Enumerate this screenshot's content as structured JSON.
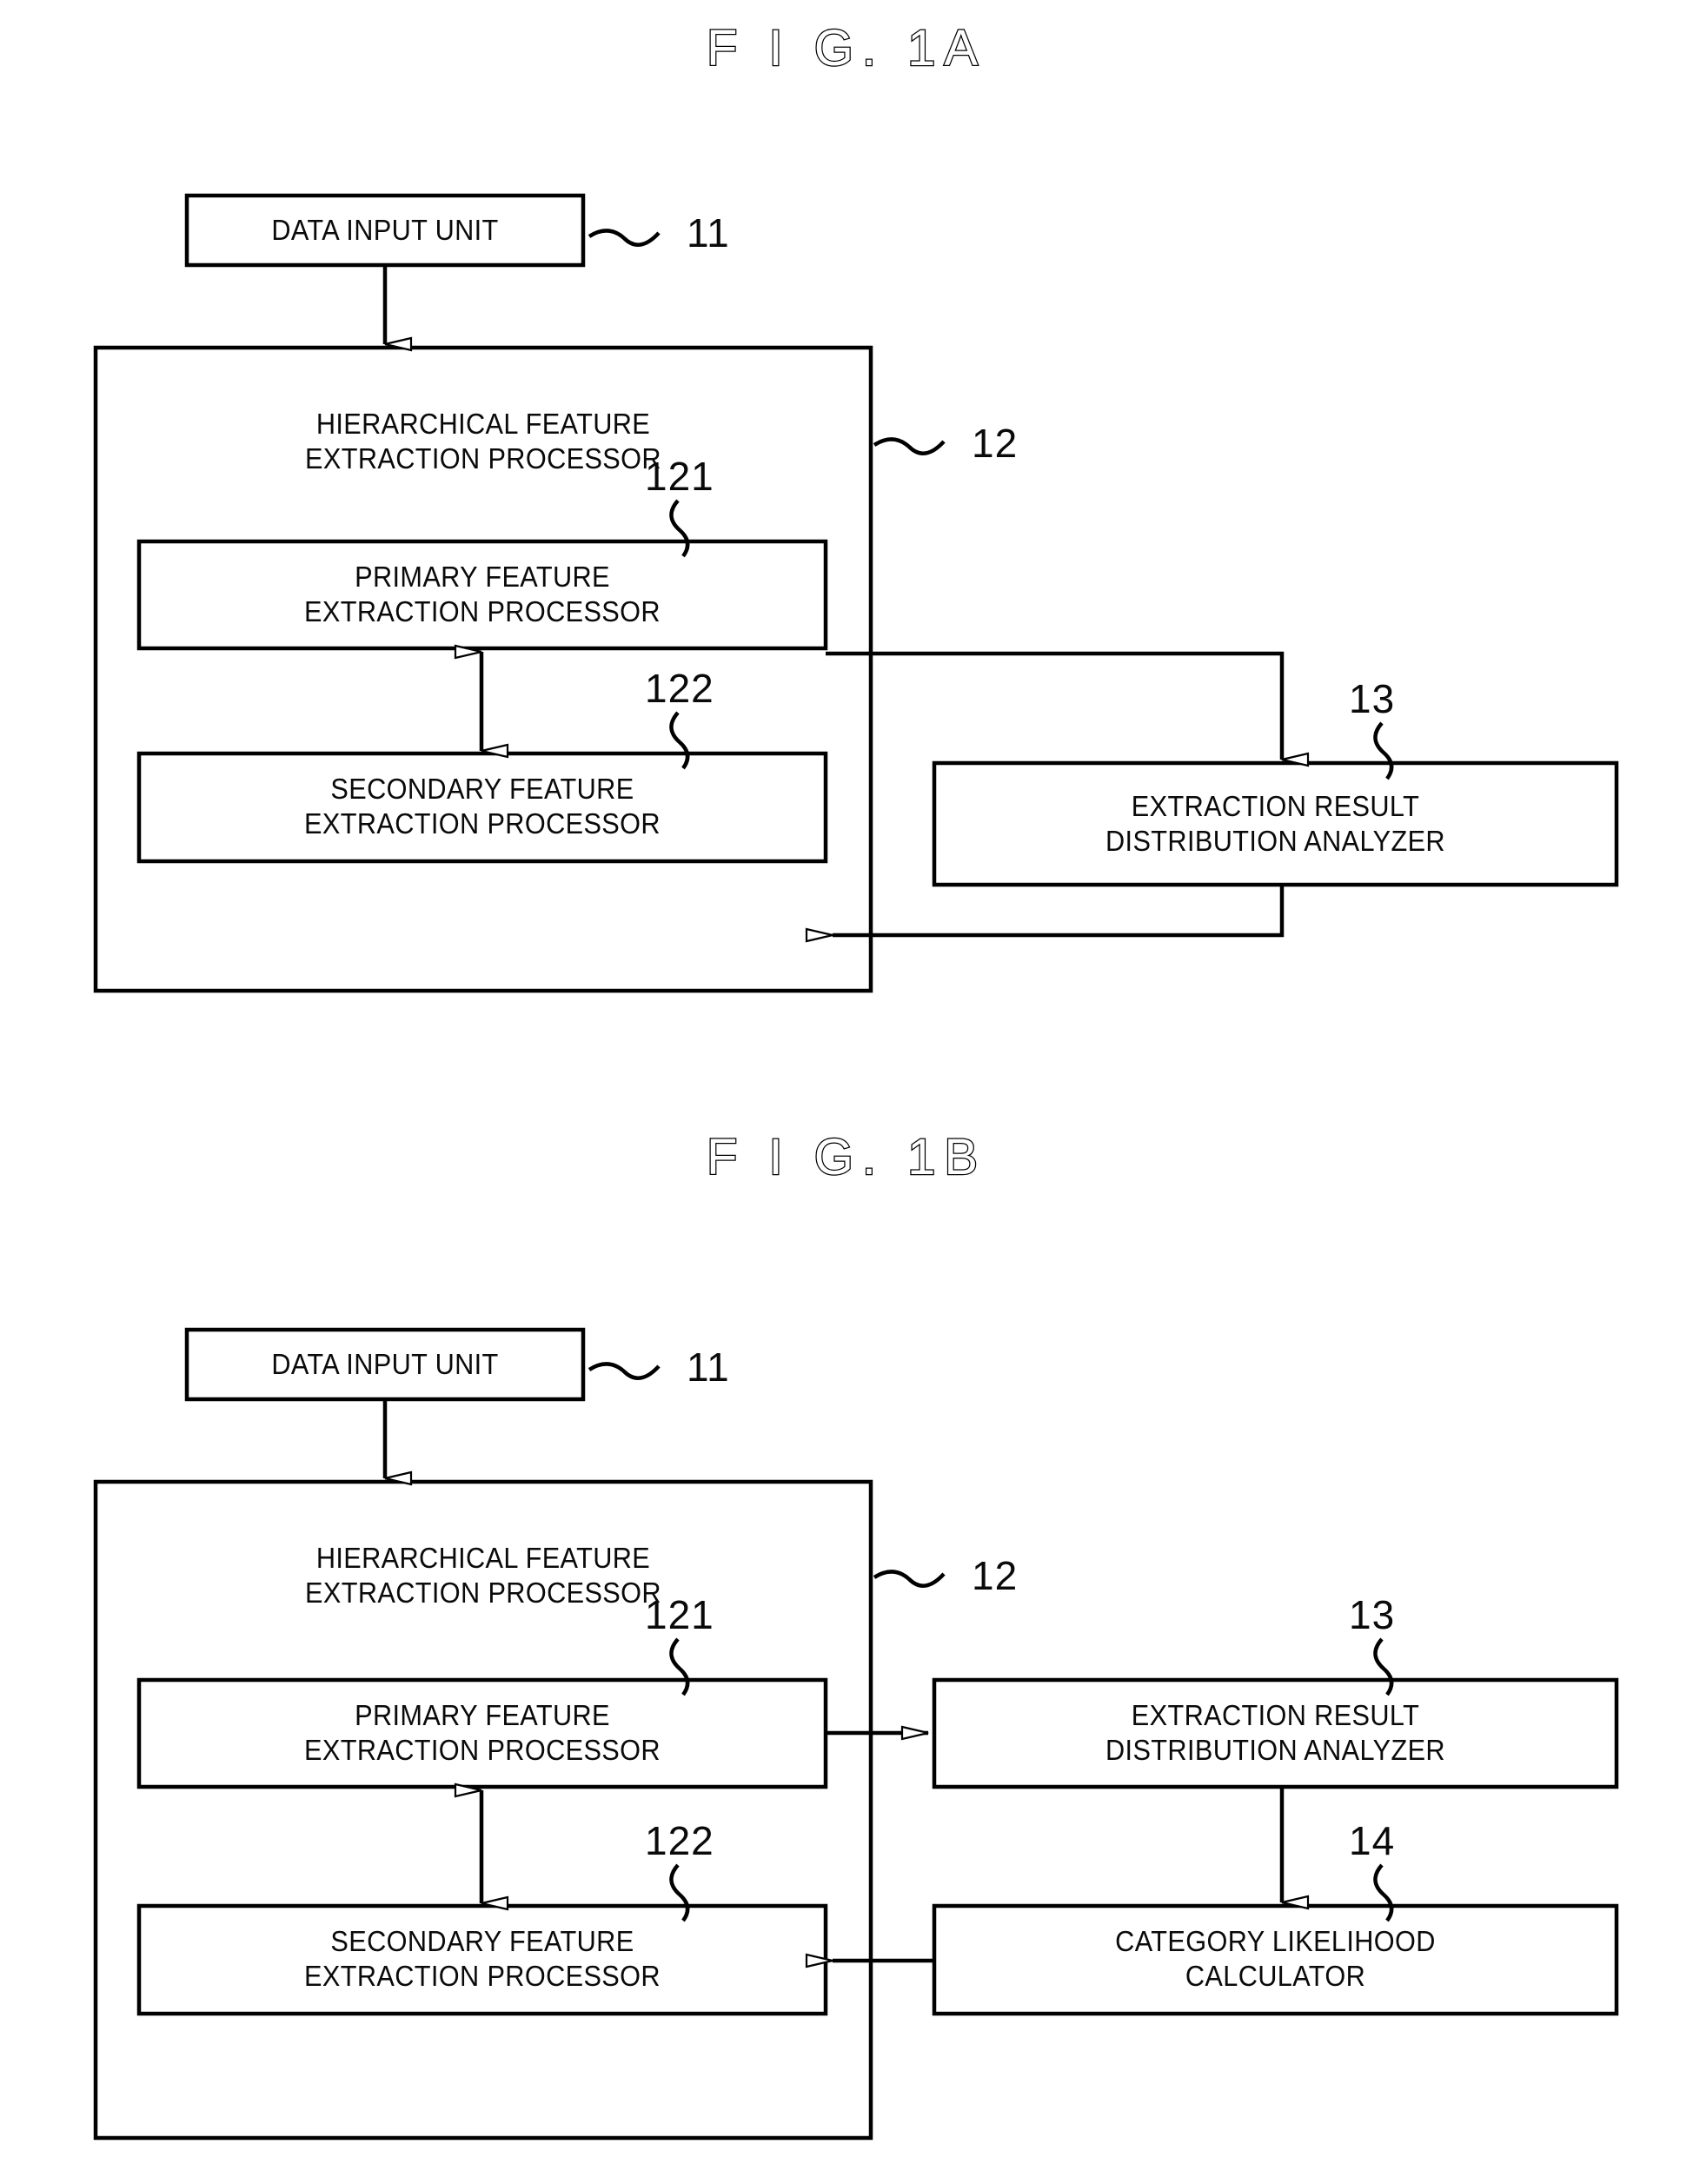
{
  "document": {
    "type": "patent-figure-sheet",
    "figures": [
      {
        "id": "fig1a",
        "caption": "F I G.  1A",
        "blocks": [
          {
            "id": "data-input-unit-a",
            "label": "DATA INPUT UNIT",
            "ref": "11"
          },
          {
            "id": "hierarchical-a",
            "label": "HIERARCHICAL FEATURE\nEXTRACTION PROCESSOR",
            "ref": "12"
          },
          {
            "id": "primary-a",
            "label": "PRIMARY FEATURE\nEXTRACTION PROCESSOR",
            "ref": "121"
          },
          {
            "id": "secondary-a",
            "label": "SECONDARY FEATURE\nEXTRACTION PROCESSOR",
            "ref": "122"
          },
          {
            "id": "analyzer-a",
            "label": "EXTRACTION RESULT\nDISTRIBUTION ANALYZER",
            "ref": "13"
          }
        ]
      },
      {
        "id": "fig1b",
        "caption": "F I G.  1B",
        "blocks": [
          {
            "id": "data-input-unit-b",
            "label": "DATA INPUT UNIT",
            "ref": "11"
          },
          {
            "id": "hierarchical-b",
            "label": "HIERARCHICAL FEATURE\nEXTRACTION PROCESSOR",
            "ref": "12"
          },
          {
            "id": "primary-b",
            "label": "PRIMARY FEATURE\nEXTRACTION PROCESSOR",
            "ref": "121"
          },
          {
            "id": "secondary-b",
            "label": "SECONDARY FEATURE\nEXTRACTION PROCESSOR",
            "ref": "122"
          },
          {
            "id": "analyzer-b",
            "label": "EXTRACTION RESULT\nDISTRIBUTION ANALYZER",
            "ref": "13"
          },
          {
            "id": "calculator-b",
            "label": "CATEGORY LIKELIHOOD\nCALCULATOR",
            "ref": "14"
          }
        ]
      }
    ],
    "colors": {
      "ink": "#000000",
      "paper": "#ffffff"
    }
  }
}
